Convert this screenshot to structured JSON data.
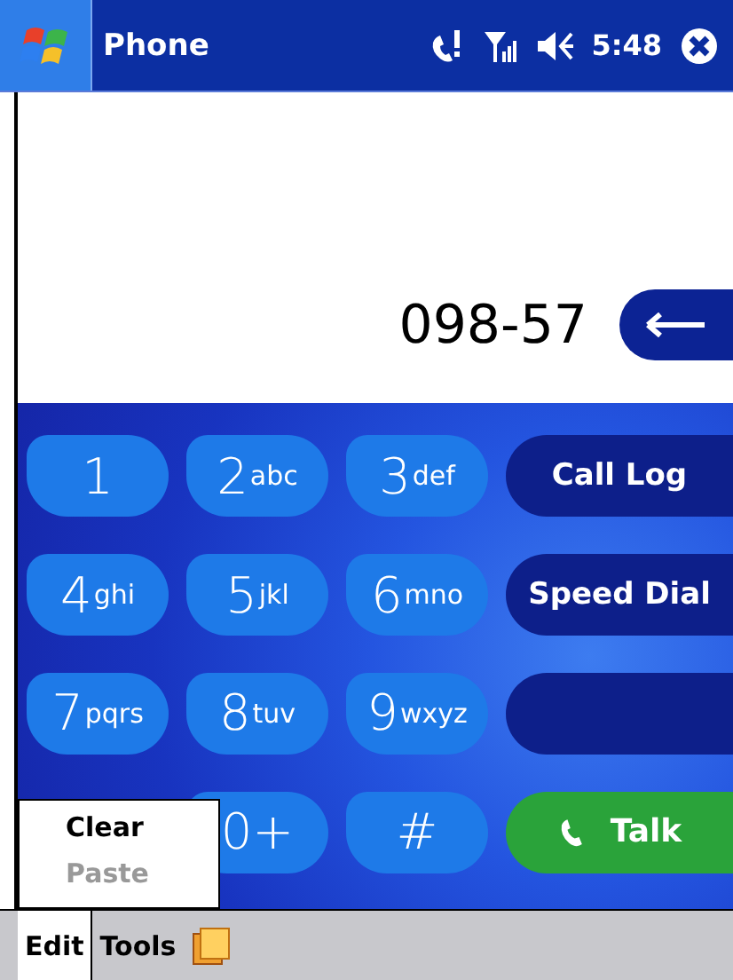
{
  "title_bar": {
    "title": "Phone",
    "time": "5:48"
  },
  "number_display": {
    "value": "098-57"
  },
  "keypad": [
    [
      {
        "kind": "digit",
        "digit": "1"
      },
      {
        "kind": "digit",
        "digit": "2",
        "letters": "abc"
      },
      {
        "kind": "digit",
        "digit": "3",
        "letters": "def"
      },
      {
        "kind": "command",
        "label": "Call Log"
      }
    ],
    [
      {
        "kind": "digit",
        "digit": "4",
        "letters": "ghi"
      },
      {
        "kind": "digit",
        "digit": "5",
        "letters": "jkl"
      },
      {
        "kind": "digit",
        "digit": "6",
        "letters": "mno"
      },
      {
        "kind": "command",
        "label": "Speed Dial"
      }
    ],
    [
      {
        "kind": "digit",
        "digit": "7",
        "letters": "pqrs"
      },
      {
        "kind": "digit",
        "digit": "8",
        "letters": "tuv"
      },
      {
        "kind": "digit",
        "digit": "9",
        "letters": "wxyz"
      },
      {
        "kind": "blank"
      }
    ],
    [
      {
        "kind": "digit",
        "digit": "0+"
      },
      {
        "kind": "digit",
        "digit": "#"
      },
      {
        "kind": "talk",
        "label": "Talk"
      }
    ]
  ],
  "menu": {
    "items": [
      {
        "label": "Clear",
        "disabled": false
      },
      {
        "label": "Paste",
        "disabled": true
      }
    ]
  },
  "menu_bar": {
    "items": [
      {
        "label": "Edit",
        "selected": true
      },
      {
        "label": "Tools",
        "selected": false
      }
    ]
  }
}
